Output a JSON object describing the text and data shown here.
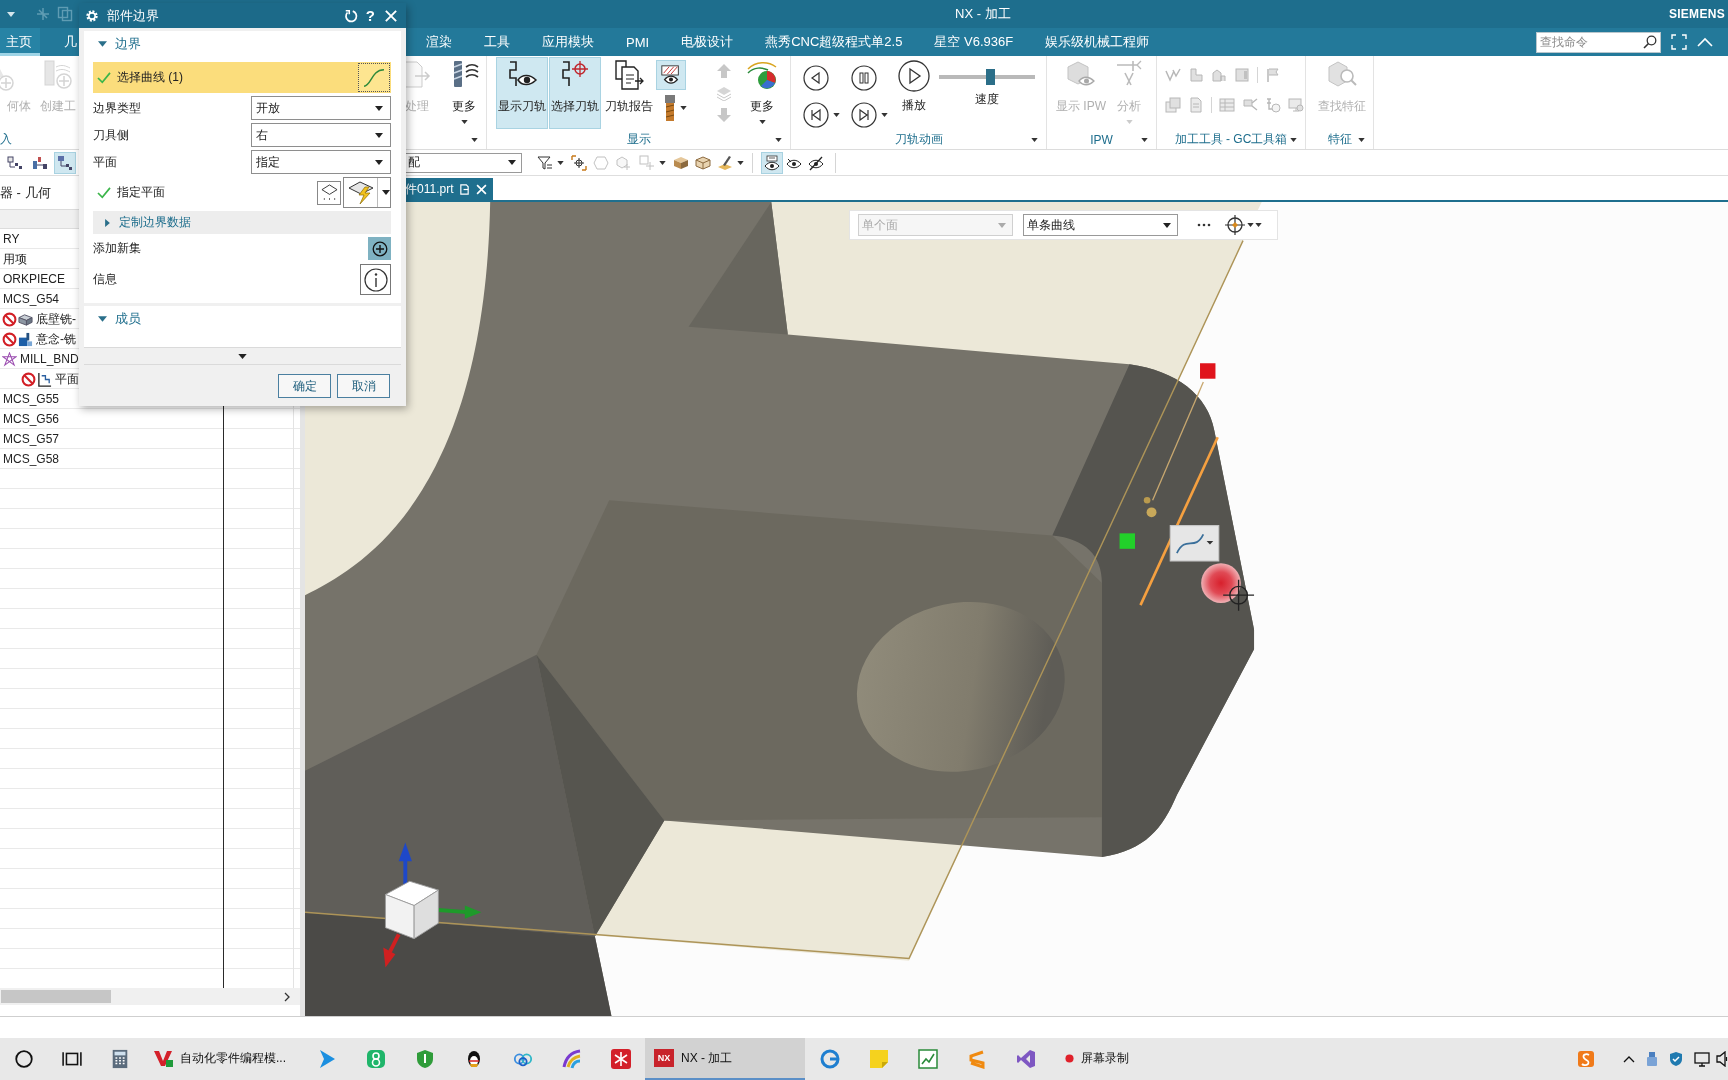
{
  "title_bar": {
    "title": "NX - 加工",
    "brand": "SIEMENS"
  },
  "menu": {
    "tabs": [
      {
        "label": "主页",
        "selected": true
      },
      {
        "label": "几",
        "selected": false
      },
      {
        "label": "渲染",
        "selected": false
      },
      {
        "label": "工具",
        "selected": false
      },
      {
        "label": "应用模块",
        "selected": false
      },
      {
        "label": "PMI",
        "selected": false
      },
      {
        "label": "电极设计",
        "selected": false
      },
      {
        "label": "燕秀CNC超级程式单2.5",
        "selected": false
      },
      {
        "label": "星空 V6.936F",
        "selected": false
      },
      {
        "label": "娱乐级机械工程师",
        "selected": false
      }
    ],
    "search": {
      "placeholder": "查找命令"
    }
  },
  "ribbon": {
    "groups": [
      {
        "label": "入",
        "buttons": [
          {
            "label": "何体",
            "disabled": true
          },
          {
            "label": "创建工",
            "disabled": true
          }
        ]
      },
      {
        "buttons": [
          {
            "label": "处理",
            "disabled": true
          },
          {
            "label": "更多",
            "disabled": false
          }
        ]
      },
      {
        "label": "显示",
        "buttons": [
          {
            "label": "显示刀轨",
            "on": true
          },
          {
            "label": "选择刀轨",
            "on": true
          },
          {
            "label": "刀轨报告",
            "on": false
          },
          {
            "label": "更多",
            "on": false
          }
        ],
        "tools": [
          {
            "on": true
          },
          {
            "on": false
          }
        ],
        "arrows": [
          {
            "disabled": true
          },
          {
            "disabled": true
          },
          {
            "disabled": true
          }
        ]
      },
      {
        "label": "刀轨动画",
        "play": {
          "label": "播放"
        },
        "speed": {
          "label": "速度",
          "level": 0.53
        }
      },
      {
        "label": "IPW",
        "disabled": true,
        "buttons": [
          {
            "label": "显示 IPW"
          },
          {
            "label": "分析"
          }
        ]
      },
      {
        "label": "加工工具 - GC工具箱",
        "disabled": true
      },
      {
        "label": "特征",
        "disabled": true,
        "buttons": [
          {
            "label": "查找特征"
          }
        ]
      }
    ]
  },
  "toolbar": {
    "navigator_views": [
      {
        "selected": false
      },
      {
        "selected": false
      },
      {
        "selected": true
      }
    ],
    "filter": {
      "value": "配"
    },
    "selection_tools": [
      {
        "disabled": false
      },
      {
        "disabled": false
      },
      {
        "disabled": true
      },
      {
        "disabled": true
      },
      {
        "disabled": true
      },
      {
        "disabled": false
      },
      {
        "disabled": false
      },
      {
        "disabled": false
      }
    ],
    "view_toggles": [
      {
        "on": true
      },
      {
        "on": false
      },
      {
        "on": false
      }
    ]
  },
  "navigator": {
    "title": "器 - 几何",
    "rows": [
      {
        "name": "RY",
        "blocked": false
      },
      {
        "name": "用项",
        "blocked": false
      },
      {
        "name": "ORKPIECE",
        "blocked": false
      },
      {
        "name": "MCS_G54",
        "blocked": false,
        "children": [
          {
            "name": "底壁铣-",
            "kind": "floor_wall",
            "blocked": true
          },
          {
            "name": "意念-铣",
            "kind": "operation",
            "blocked": true
          },
          {
            "name": "MILL_BND",
            "kind": "boundary",
            "blocked": false,
            "children": [
              {
                "name": "平面",
                "kind": "planar",
                "blocked": true
              }
            ]
          }
        ]
      },
      {
        "name": "MCS_G55",
        "blocked": false
      },
      {
        "name": "MCS_G56",
        "blocked": false
      },
      {
        "name": "MCS_G57",
        "blocked": false
      },
      {
        "name": "MCS_G58",
        "blocked": false
      }
    ]
  },
  "document_tab": {
    "label": "件011.prt"
  },
  "viewport": {
    "selection_bar": {
      "face_rule": {
        "value": "单个面",
        "disabled": true
      },
      "curve_rule": {
        "value": "单条曲线",
        "disabled": false
      }
    }
  },
  "dialog": {
    "title": "部件边界",
    "help": "?",
    "boundary": {
      "title": "边界",
      "expanded": true,
      "select_curve": {
        "label": "选择曲线 (1)",
        "selected": true,
        "done": true
      },
      "fields": [
        {
          "label": "边界类型",
          "value": "开放"
        },
        {
          "label": "刀具侧",
          "value": "右"
        },
        {
          "label": "平面",
          "value": "指定"
        }
      ],
      "specify_plane": {
        "label": "指定平面",
        "done": true
      },
      "custom_data": {
        "title": "定制边界数据",
        "expanded": false
      },
      "add_set": {
        "label": "添加新集"
      },
      "info": {
        "label": "信息"
      }
    },
    "members": {
      "title": "成员",
      "expanded": true
    },
    "buttons": [
      {
        "label": "确定"
      },
      {
        "label": "取消"
      }
    ]
  },
  "taskbar": {
    "apps": [
      {
        "label": "自动化零件编程模...",
        "selected": false
      },
      {
        "label": "NX - 加工",
        "logo": "NX",
        "selected": true
      },
      {
        "label": "屏幕录制",
        "selected": false
      }
    ]
  }
}
